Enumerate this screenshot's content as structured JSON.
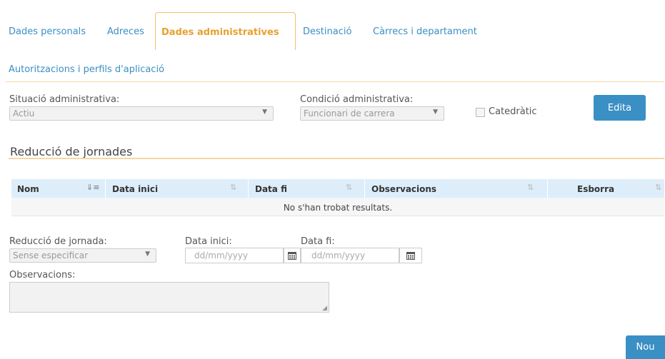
{
  "tabs": {
    "personal": "Dades personals",
    "addresses": "Adreces",
    "admin": "Dades administratives",
    "destination": "Destinació",
    "positions": "Càrrecs i departament",
    "authorizations": "Autoritzacions i perfils d'aplicació"
  },
  "admin_form": {
    "situation_label": "Situació administrativa:",
    "situation_value": "Actiu",
    "condition_label": "Condició administrativa:",
    "condition_value": "Funcionari de carrera",
    "catedratic_label": "Catedràtic",
    "edit_button": "Edita"
  },
  "reduction": {
    "title": "Reducció de jornades",
    "columns": [
      "Nom",
      "Data inici",
      "Data fi",
      "Observacions",
      "Esborra"
    ],
    "empty_message": "No s'han trobat resultats."
  },
  "new_form": {
    "reduction_label": "Reducció de jornada:",
    "reduction_value": "Sense especificar",
    "start_label": "Data inici:",
    "start_placeholder": "dd/mm/yyyy",
    "end_label": "Data fi:",
    "end_placeholder": "dd/mm/yyyy",
    "observations_label": "Observacions:",
    "new_button": "Nou"
  },
  "colors": {
    "accent": "#3a8fc4",
    "active_tab": "#e8a030",
    "header_bg": "#ddeefa"
  }
}
